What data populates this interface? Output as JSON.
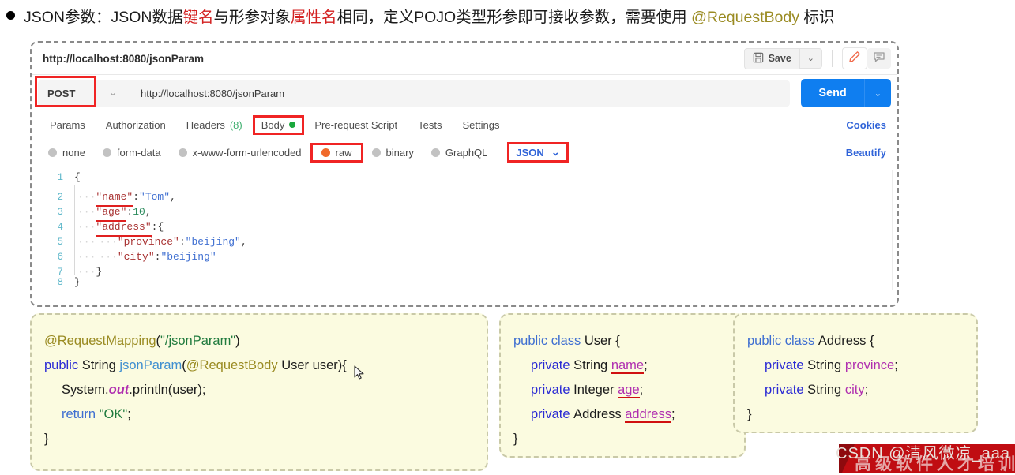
{
  "heading": {
    "bullet": "bullet-dot",
    "prefix": "JSON参数：JSON数据",
    "hl1": "键名",
    "mid1": "与形参对象",
    "hl2": "属性名",
    "mid2": "相同，定义POJO类型形参即可接收参数，需要使用 ",
    "annotation": "@RequestBody",
    "suffix": " 标识"
  },
  "postman": {
    "tab_url": "http://localhost:8080/jsonParam",
    "save_label": "Save",
    "save_caret": "⌄",
    "save_icon": "floppy-disk-icon",
    "edit_icon": "pencil-icon",
    "comment_icon": "comment-icon",
    "method": "POST",
    "method_caret": "⌄",
    "url_value": "http://localhost:8080/jsonParam",
    "send_label": "Send",
    "send_caret": "⌄",
    "tabs": [
      {
        "label": "Params",
        "badge": "",
        "dot": false,
        "highlight": false
      },
      {
        "label": "Authorization",
        "badge": "",
        "dot": false,
        "highlight": false
      },
      {
        "label": "Headers",
        "badge": "(8)",
        "dot": false,
        "highlight": false
      },
      {
        "label": "Body",
        "badge": "",
        "dot": true,
        "highlight": true
      },
      {
        "label": "Pre-request Script",
        "badge": "",
        "dot": false,
        "highlight": false
      },
      {
        "label": "Tests",
        "badge": "",
        "dot": false,
        "highlight": false
      },
      {
        "label": "Settings",
        "badge": "",
        "dot": false,
        "highlight": false
      }
    ],
    "cookies_label": "Cookies",
    "body_options": [
      {
        "label": "none",
        "selected": false,
        "highlight": false
      },
      {
        "label": "form-data",
        "selected": false,
        "highlight": false
      },
      {
        "label": "x-www-form-urlencoded",
        "selected": false,
        "highlight": false
      },
      {
        "label": "raw",
        "selected": true,
        "highlight": true
      },
      {
        "label": "binary",
        "selected": false,
        "highlight": false
      },
      {
        "label": "GraphQL",
        "selected": false,
        "highlight": false
      }
    ],
    "format_select": "JSON",
    "format_caret": "⌄",
    "beautify_label": "Beautify",
    "editor_lines": [
      {
        "n": "1",
        "indent": "",
        "bar": false,
        "text": "{"
      },
      {
        "n": "2",
        "indent": "····",
        "bar": true,
        "text": "\"name\":\"Tom\","
      },
      {
        "n": "3",
        "indent": "····",
        "bar": true,
        "text": "\"age\":10,"
      },
      {
        "n": "4",
        "indent": "····",
        "bar": true,
        "text": "\"address\":{"
      },
      {
        "n": "5",
        "indent": "········",
        "bar": true,
        "text": "\"province\":\"beijing\","
      },
      {
        "n": "6",
        "indent": "········",
        "bar": true,
        "text": "\"city\":\"beijing\""
      },
      {
        "n": "7",
        "indent": "····",
        "bar": true,
        "text": "}"
      },
      {
        "n": "8",
        "indent": "",
        "bar": false,
        "text": "}"
      }
    ]
  },
  "cards": {
    "controller": {
      "line1_ann": "@RequestMapping",
      "line1_str": "\"/jsonParam\"",
      "line2_kw": "public",
      "line2_type": "String",
      "line2_meth": "jsonParam",
      "line2_ann": "@RequestBody",
      "line2_param": "User user",
      "line3": "System.",
      "line3_italic": "out",
      "line3_rest": ".println(user);",
      "line4_kw": "return",
      "line4_str": "\"OK\"",
      "line5": "}"
    },
    "user": {
      "header_kw": "public class",
      "header_name": "User {",
      "fields": [
        {
          "kw": "private",
          "type": "String",
          "name": "name",
          "semi": ";"
        },
        {
          "kw": "private",
          "type": "Integer",
          "name": "age",
          "semi": ";"
        },
        {
          "kw": "private",
          "type": "Address",
          "name": "address",
          "semi": ";"
        }
      ],
      "close": "}"
    },
    "address": {
      "header_kw": "public class",
      "header_name": "Address {",
      "fields": [
        {
          "kw": "private",
          "type": "String",
          "name": "province",
          "semi": ";"
        },
        {
          "kw": "private",
          "type": "String",
          "name": "city",
          "semi": ";"
        }
      ],
      "close": "}"
    }
  },
  "watermark": {
    "text": "CSDN @清风微凉_aaa",
    "ribbon_text": "高级软件人才培训"
  },
  "colors": {
    "accent_blue": "#0f7ef0",
    "highlight_red": "#f02424",
    "annotation_olive": "#9a8b22",
    "card_bg": "#fbfbe0",
    "ribbon_red": "#c00d12"
  }
}
